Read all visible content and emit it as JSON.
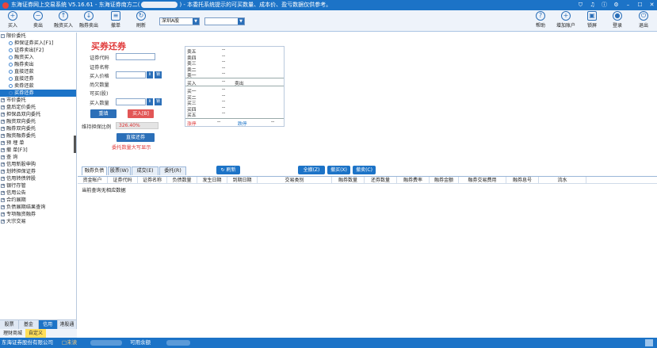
{
  "window": {
    "title": "东海证券网上交易系统 V5.16.61 - 东海证券南方二(",
    "title_tail": ") - 本委托系统提示的可买数量、成本价、盈亏数据仅供参考。"
  },
  "toolbar": {
    "left_buttons": [
      {
        "label": "买入",
        "icon": "buy-icon"
      },
      {
        "label": "卖出",
        "icon": "sell-icon"
      },
      {
        "label": "融资买入",
        "icon": "margin-buy-icon"
      },
      {
        "label": "融券卖出",
        "icon": "short-sell-icon"
      },
      {
        "label": "撤单",
        "icon": "cancel-order-icon"
      },
      {
        "label": "刷新",
        "icon": "refresh-icon"
      }
    ],
    "market_select": "深圳A股",
    "right_buttons": [
      {
        "label": "帮助",
        "icon": "help-icon"
      },
      {
        "label": "增加账户",
        "icon": "add-account-icon"
      },
      {
        "label": "锁屏",
        "icon": "lock-icon"
      },
      {
        "label": "登录",
        "icon": "user-icon"
      },
      {
        "label": "退出",
        "icon": "power-icon"
      }
    ]
  },
  "sidebar": {
    "items": [
      {
        "label": "限价委托",
        "level": 0,
        "expander": "-"
      },
      {
        "label": "担保证券买入[F1]",
        "level": 1
      },
      {
        "label": "证券卖出[F2]",
        "level": 1
      },
      {
        "label": "融资买入",
        "level": 1
      },
      {
        "label": "融券卖出",
        "level": 1
      },
      {
        "label": "直接还款",
        "level": 1
      },
      {
        "label": "直接还券",
        "level": 1
      },
      {
        "label": "卖券还款",
        "level": 1
      },
      {
        "label": "买券还券",
        "level": 1,
        "selected": true
      },
      {
        "label": "市价委托",
        "level": 0,
        "expander": "+"
      },
      {
        "label": "盘后定价委托",
        "level": 0,
        "expander": "+"
      },
      {
        "label": "担保品双向委托",
        "level": 0,
        "expander": "+"
      },
      {
        "label": "融资双向委托",
        "level": 0,
        "expander": "+"
      },
      {
        "label": "融券双向委托",
        "level": 0,
        "expander": "+"
      },
      {
        "label": "融资融券委托",
        "level": 0,
        "expander": "+"
      },
      {
        "label": "预 埋 单",
        "level": 0,
        "expander": "+"
      },
      {
        "label": "撤      单[F3]",
        "level": 0,
        "expander": "+"
      },
      {
        "label": "查      询",
        "level": 0,
        "expander": "+"
      },
      {
        "label": "信用新股申购",
        "level": 0,
        "expander": "+"
      },
      {
        "label": "划转担保证券",
        "level": 0,
        "expander": "+"
      },
      {
        "label": "信用转债转股",
        "level": 0,
        "expander": "+"
      },
      {
        "label": "银行存管",
        "level": 0,
        "expander": "+"
      },
      {
        "label": "信用公告",
        "level": 0,
        "expander": "+"
      },
      {
        "label": "合约展期",
        "level": 0,
        "expander": "+"
      },
      {
        "label": "负债展期结果查询",
        "level": 0,
        "expander": "+"
      },
      {
        "label": "专项融资融券",
        "level": 0,
        "expander": "+"
      },
      {
        "label": "大宗交易",
        "level": 0,
        "expander": "+"
      }
    ],
    "tabs": [
      "股票",
      "基金",
      "信用",
      "港股通"
    ],
    "active_tab": 2,
    "tabs2": [
      "理财商城",
      "自定义"
    ]
  },
  "form": {
    "title": "买券还券",
    "code_label": "证券代码",
    "name_label": "证券名称",
    "price_label": "买入价格",
    "owed_label": "尚欠数量",
    "avail_label": "可买(股)",
    "qty_label": "买入数量",
    "lock_btn": "锁",
    "reset_btn": "重填",
    "buy_btn": "买入[B]",
    "ratio_label": "维持担保比例",
    "ratio_value": "326.40%",
    "direct_repay_btn": "直接还券",
    "hint": "委托数量大写显示"
  },
  "quote": {
    "sell_rows": [
      "卖五",
      "卖四",
      "卖三",
      "卖二",
      "卖一"
    ],
    "dash": "--",
    "buy_label": "买入",
    "sell_label": "卖出",
    "buy_rows": [
      "买一",
      "买二",
      "买三",
      "买四",
      "买五"
    ],
    "rise_label": "涨停",
    "fall_label": "跌停"
  },
  "bottom": {
    "tabs": [
      "融券负债",
      "股票(W)",
      "成交(E)",
      "委托(R)"
    ],
    "refresh": "刷新",
    "buttons": [
      "全撤(Z)",
      "撤买(X)",
      "撤卖(C)"
    ],
    "columns": [
      "资金帐户",
      "证券代码",
      "证券名称",
      "负债数量",
      "发生日期",
      "到期日期",
      "交易类别",
      "融券数量",
      "还券数量",
      "融券费率",
      "融券金额",
      "融券交易费用",
      "融券息号",
      "流水"
    ],
    "empty": "当前查询无相应数据"
  },
  "status": {
    "company": "东海证券股份有限公司",
    "item2": "□未读",
    "avail": "可用余额"
  }
}
